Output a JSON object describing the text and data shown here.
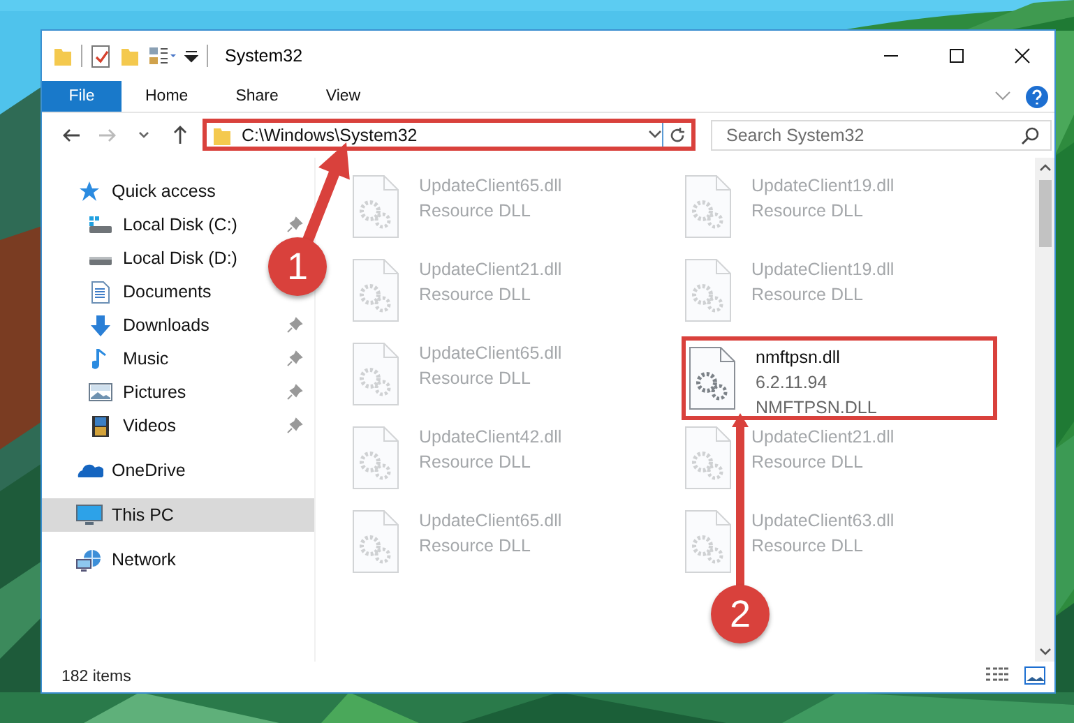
{
  "window": {
    "title": "System32"
  },
  "ribbon": {
    "tabs": [
      {
        "label": "File",
        "kind": "file"
      },
      {
        "label": "Home",
        "kind": "tab"
      },
      {
        "label": "Share",
        "kind": "tab"
      },
      {
        "label": "View",
        "kind": "tab"
      }
    ]
  },
  "address_bar": {
    "path": "C:\\Windows\\System32",
    "highlighted": true
  },
  "search": {
    "placeholder": "Search System32"
  },
  "navigation": [
    {
      "label": "Quick access",
      "kind": "star",
      "selected": false,
      "children": [
        {
          "label": "Local Disk (C:)",
          "kind": "system-drive",
          "pinned": true
        },
        {
          "label": "Local Disk (D:)",
          "kind": "drive"
        },
        {
          "label": "Documents",
          "kind": "documents",
          "pinned": false
        },
        {
          "label": "Downloads",
          "kind": "downloads",
          "pinned": true
        },
        {
          "label": "Music",
          "kind": "music",
          "pinned": true
        },
        {
          "label": "Pictures",
          "kind": "pictures",
          "pinned": true
        },
        {
          "label": "Videos",
          "kind": "videos",
          "pinned": true
        }
      ]
    },
    {
      "label": "OneDrive",
      "kind": "cloud",
      "selected": false
    },
    {
      "label": "This PC",
      "kind": "computer",
      "selected": true
    },
    {
      "label": "Network",
      "kind": "network",
      "selected": false
    }
  ],
  "files": [
    {
      "name": "UpdateClient65.dll",
      "lines": [
        "Resource DLL"
      ],
      "dimmed": true,
      "highlighted": false
    },
    {
      "name": "UpdateClient19.dll",
      "lines": [
        "Resource DLL"
      ],
      "dimmed": true,
      "highlighted": false
    },
    {
      "name": "UpdateClient21.dll",
      "lines": [
        "Resource DLL"
      ],
      "dimmed": true,
      "highlighted": false
    },
    {
      "name": "UpdateClient19.dll",
      "lines": [
        "Resource DLL"
      ],
      "dimmed": true,
      "highlighted": false
    },
    {
      "name": "UpdateClient65.dll",
      "lines": [
        "Resource DLL"
      ],
      "dimmed": true,
      "highlighted": false
    },
    {
      "name": "nmftpsn.dll",
      "lines": [
        "6.2.11.94",
        "NMFTPSN.DLL"
      ],
      "dimmed": false,
      "highlighted": true
    },
    {
      "name": "UpdateClient42.dll",
      "lines": [
        "Resource DLL"
      ],
      "dimmed": true,
      "highlighted": false
    },
    {
      "name": "UpdateClient21.dll",
      "lines": [
        "Resource DLL"
      ],
      "dimmed": true,
      "highlighted": false
    },
    {
      "name": "UpdateClient65.dll",
      "lines": [
        "Resource DLL"
      ],
      "dimmed": true,
      "highlighted": false
    },
    {
      "name": "UpdateClient63.dll",
      "lines": [
        "Resource DLL"
      ],
      "dimmed": true,
      "highlighted": false
    }
  ],
  "status_bar": {
    "item_count": "182 items"
  },
  "callouts": [
    {
      "number": "1"
    },
    {
      "number": "2"
    }
  ]
}
